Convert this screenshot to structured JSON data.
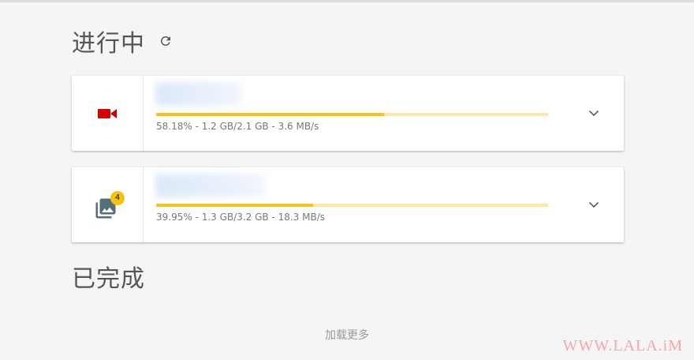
{
  "sections": {
    "in_progress_title": "进行中",
    "completed_title": "已完成"
  },
  "icons": {
    "refresh": "refresh-icon",
    "video": "video-camera-icon",
    "images": "photo-library-icon",
    "expand": "chevron-down-icon"
  },
  "colors": {
    "progress_fill": "#f7c31b",
    "progress_track": "#fbe7a9",
    "video_icon": "#d50000",
    "images_icon": "#546e7a",
    "badge": "#f5c211"
  },
  "downloads": [
    {
      "type": "video",
      "progress": 0.5818,
      "stats": "58.18% - 1.2 GB/2.1 GB - 3.6 MB/s"
    },
    {
      "type": "images",
      "badge": "4",
      "progress": 0.3995,
      "stats": "39.95% - 1.3 GB/3.2 GB - 18.3 MB/s"
    }
  ],
  "load_more": "加载更多",
  "watermark": "WWW.LALA.iM"
}
